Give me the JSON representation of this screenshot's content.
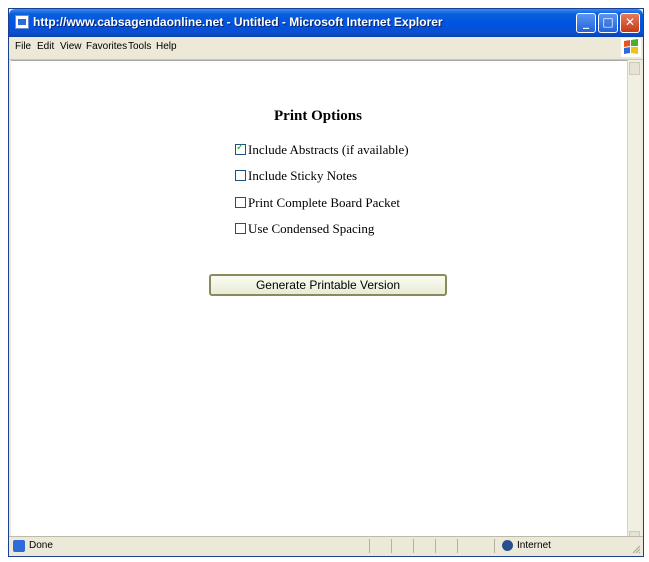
{
  "window": {
    "title": "http://www.cabsagendaonline.net - Untitled - Microsoft Internet Explorer",
    "min_glyph": "_",
    "max_glyph": "□",
    "close_glyph": "✕"
  },
  "menubar": {
    "items": [
      "File",
      "Edit",
      "View",
      "Favorites",
      "Tools",
      "Help"
    ]
  },
  "page": {
    "heading": "Print Options",
    "options": [
      {
        "label": "Include Abstracts (if available)",
        "checked": true
      },
      {
        "label": "Include Sticky Notes",
        "checked": false
      },
      {
        "label": "Print Complete Board Packet",
        "checked": false
      },
      {
        "label": "Use Condensed Spacing",
        "checked": false
      }
    ],
    "generate_button": "Generate Printable Version"
  },
  "statusbar": {
    "status": "Done",
    "zone": "Internet"
  },
  "colors": {
    "titlebar": "#0054e3",
    "chrome": "#ece9d8",
    "close_button": "#c43c15",
    "checkbox_border": "#1c5180",
    "checkmark": "#21a121"
  },
  "icons": [
    "ie-page-icon",
    "minimize-icon",
    "maximize-icon",
    "close-icon",
    "windows-logo-icon",
    "checkbox-icon",
    "checkmark-icon",
    "done-page-icon",
    "internet-globe-icon"
  ]
}
